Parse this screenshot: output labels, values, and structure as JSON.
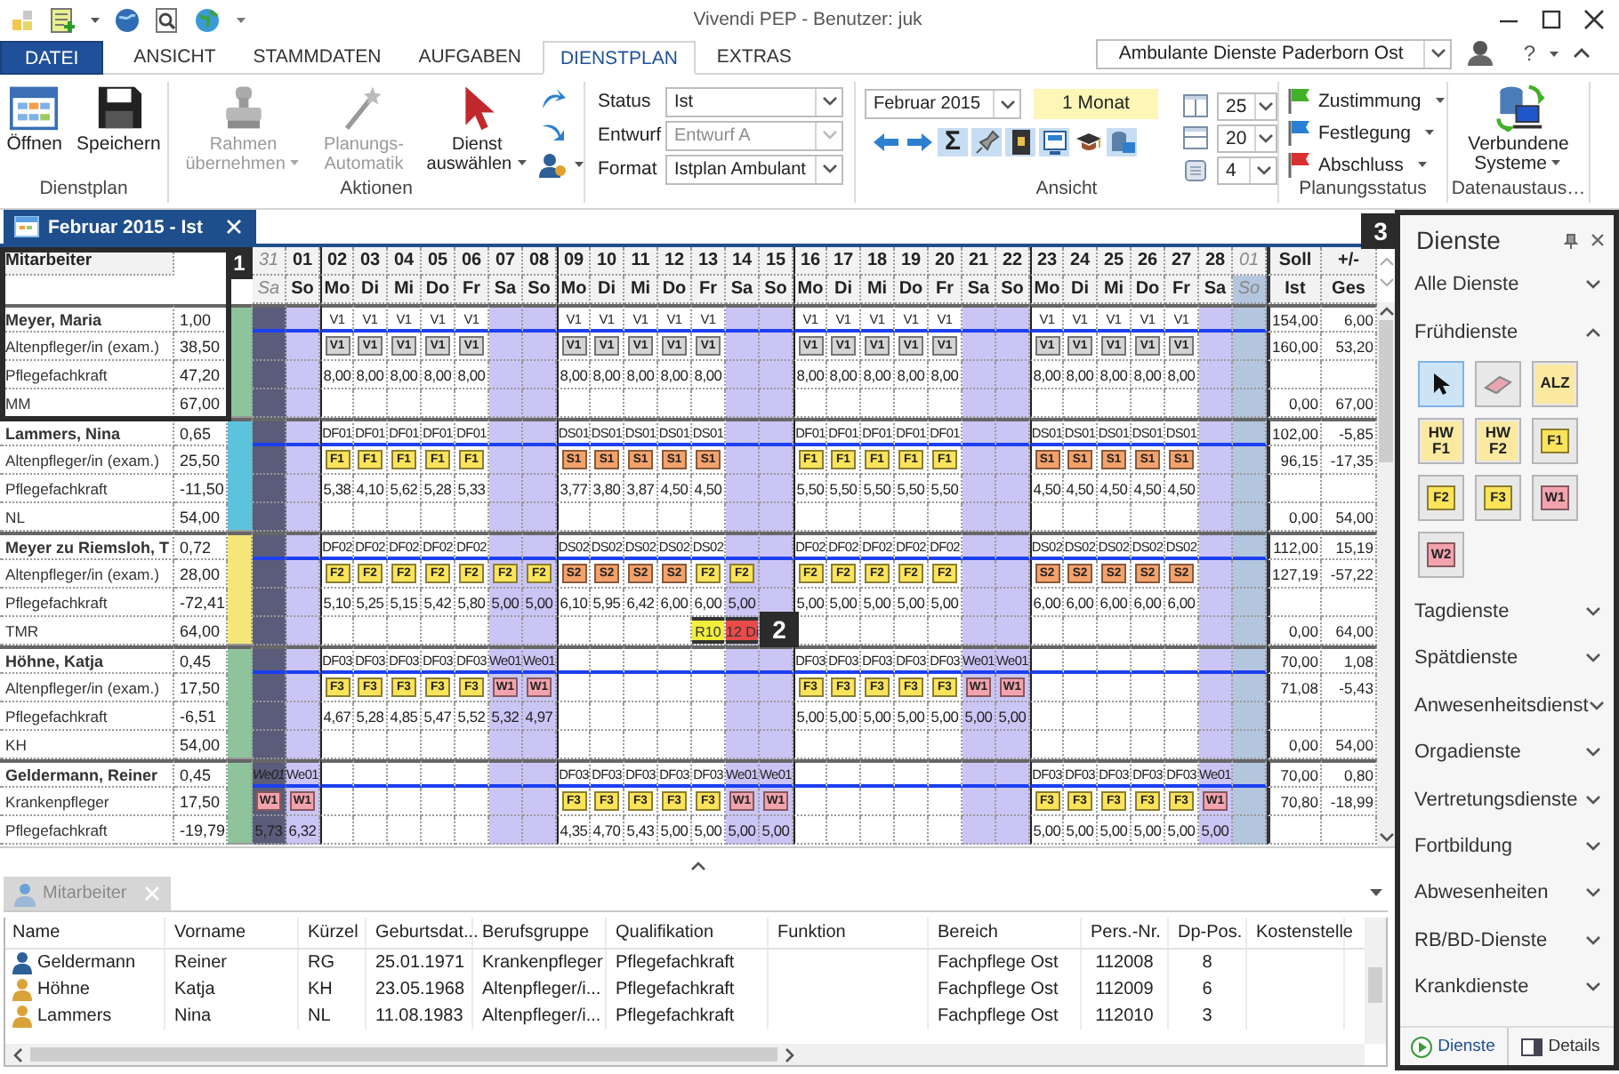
{
  "window": {
    "title": "Vivendi PEP - Benutzer: juk"
  },
  "ribbon_tabs": [
    {
      "label": "DATEI",
      "kind": "file",
      "selected": false
    },
    {
      "label": "ANSICHT",
      "kind": "tab",
      "selected": false
    },
    {
      "label": "STAMMDATEN",
      "kind": "tab",
      "selected": false
    },
    {
      "label": "AUFGABEN",
      "kind": "tab",
      "selected": false
    },
    {
      "label": "DIENSTPLAN",
      "kind": "tab",
      "selected": true
    },
    {
      "label": "EXTRAS",
      "kind": "tab",
      "selected": false
    }
  ],
  "location": "Ambulante Dienste Paderborn Ost",
  "help": "?",
  "ribbon": {
    "dienstplan": {
      "label": "Dienstplan",
      "buttons": [
        {
          "label": "Öffnen"
        },
        {
          "label": "Speichern"
        }
      ]
    },
    "aktionen": {
      "label": "Aktionen",
      "buttons": [
        {
          "label": "Rahmen übernehmen",
          "disabled": true,
          "dropdown": true
        },
        {
          "label": "Planungs-Automatik",
          "disabled": true,
          "dropdown": false
        },
        {
          "label": "Dienst auswählen",
          "disabled": false,
          "dropdown": true
        }
      ]
    },
    "fields": [
      {
        "label": "Status",
        "value": "Ist",
        "disabled": false
      },
      {
        "label": "Entwurf",
        "value": "Entwurf A",
        "disabled": true
      },
      {
        "label": "Format",
        "value": "Istplan Ambulant",
        "disabled": false
      }
    ],
    "ansicht": {
      "label": "Ansicht",
      "month": "Februar 2015",
      "range": "1 Monat",
      "tools": [
        {
          "kind": "back",
          "pressed": false
        },
        {
          "kind": "forward",
          "pressed": false
        },
        {
          "kind": "sum",
          "label": "Σ",
          "pressed": true
        },
        {
          "kind": "pin",
          "pressed": true
        },
        {
          "kind": "book",
          "pressed": true
        },
        {
          "kind": "monitor",
          "pressed": true
        },
        {
          "kind": "cap",
          "pressed": false
        },
        {
          "kind": "database",
          "pressed": true
        }
      ],
      "spinners": [
        {
          "kind": "columns",
          "value": "25"
        },
        {
          "kind": "rows",
          "value": "20"
        },
        {
          "kind": "square",
          "value": "4"
        }
      ]
    },
    "planungsstatus": {
      "label": "Planungsstatus",
      "items": [
        {
          "label": "Zustimmung",
          "color": "#43b02a"
        },
        {
          "label": "Festlegung",
          "color": "#2a7fd4"
        },
        {
          "label": "Abschluss",
          "color": "#d83030"
        }
      ]
    },
    "datenaustausch": {
      "label": "Datenaustaus…",
      "button": "Verbundene Systeme"
    }
  },
  "document_tab": "Februar 2015 - Ist",
  "grid": {
    "name_header": "Mitarbeiter",
    "totals_headers": [
      {
        "top": "Soll",
        "bottom": "Ist"
      },
      {
        "top": "+/-",
        "bottom": "Ges"
      }
    ]
  },
  "days": [
    {
      "day": "31",
      "weekday": "Sa",
      "kind": "prev"
    },
    {
      "day": "01",
      "weekday": "So",
      "kind": "weekend"
    },
    {
      "day": "02",
      "weekday": "Mo",
      "kind": "weekday"
    },
    {
      "day": "03",
      "weekday": "Di",
      "kind": "weekday"
    },
    {
      "day": "04",
      "weekday": "Mi",
      "kind": "weekday"
    },
    {
      "day": "05",
      "weekday": "Do",
      "kind": "weekday"
    },
    {
      "day": "06",
      "weekday": "Fr",
      "kind": "weekday"
    },
    {
      "day": "07",
      "weekday": "Sa",
      "kind": "weekend"
    },
    {
      "day": "08",
      "weekday": "So",
      "kind": "weekend"
    },
    {
      "day": "09",
      "weekday": "Mo",
      "kind": "weekday"
    },
    {
      "day": "10",
      "weekday": "Di",
      "kind": "weekday"
    },
    {
      "day": "11",
      "weekday": "Mi",
      "kind": "weekday"
    },
    {
      "day": "12",
      "weekday": "Do",
      "kind": "weekday"
    },
    {
      "day": "13",
      "weekday": "Fr",
      "kind": "weekday"
    },
    {
      "day": "14",
      "weekday": "Sa",
      "kind": "weekend"
    },
    {
      "day": "15",
      "weekday": "So",
      "kind": "weekend"
    },
    {
      "day": "16",
      "weekday": "Mo",
      "kind": "weekday"
    },
    {
      "day": "17",
      "weekday": "Di",
      "kind": "weekday"
    },
    {
      "day": "18",
      "weekday": "Mi",
      "kind": "weekday"
    },
    {
      "day": "19",
      "weekday": "Do",
      "kind": "weekday"
    },
    {
      "day": "20",
      "weekday": "Fr",
      "kind": "weekday"
    },
    {
      "day": "21",
      "weekday": "Sa",
      "kind": "weekend"
    },
    {
      "day": "22",
      "weekday": "So",
      "kind": "weekend"
    },
    {
      "day": "23",
      "weekday": "Mo",
      "kind": "weekday"
    },
    {
      "day": "24",
      "weekday": "Di",
      "kind": "weekday"
    },
    {
      "day": "25",
      "weekday": "Mi",
      "kind": "weekday"
    },
    {
      "day": "26",
      "weekday": "Do",
      "kind": "weekday"
    },
    {
      "day": "27",
      "weekday": "Fr",
      "kind": "weekday"
    },
    {
      "day": "28",
      "weekday": "Sa",
      "kind": "weekend"
    },
    {
      "day": "01",
      "weekday": "So",
      "kind": "next"
    }
  ],
  "employees": [
    {
      "color": "#8ec39c",
      "rows": [
        {
          "label": "Meyer, Maria",
          "value": "1,00",
          "kind": "codes",
          "soll": "154,00",
          "diff": "6,00",
          "cells": [
            null,
            null,
            "V1",
            "V1",
            "V1",
            "V1",
            "V1",
            null,
            null,
            "V1",
            "V1",
            "V1",
            "V1",
            "V1",
            null,
            null,
            "V1",
            "V1",
            "V1",
            "V1",
            "V1",
            null,
            null,
            "V1",
            "V1",
            "V1",
            "V1",
            "V1",
            null,
            null
          ]
        },
        {
          "label": "Altenpfleger/in (exam.)",
          "value": "38,50",
          "kind": "badges",
          "soll": "160,00",
          "diff": "53,20",
          "cells": [
            null,
            null,
            {
              "code": "V1",
              "color": "#d4d4d4"
            },
            {
              "code": "V1",
              "color": "#d4d4d4"
            },
            {
              "code": "V1",
              "color": "#d4d4d4"
            },
            {
              "code": "V1",
              "color": "#d4d4d4"
            },
            {
              "code": "V1",
              "color": "#d4d4d4"
            },
            null,
            null,
            {
              "code": "V1",
              "color": "#d4d4d4"
            },
            {
              "code": "V1",
              "color": "#d4d4d4"
            },
            {
              "code": "V1",
              "color": "#d4d4d4"
            },
            {
              "code": "V1",
              "color": "#d4d4d4"
            },
            {
              "code": "V1",
              "color": "#d4d4d4"
            },
            null,
            null,
            {
              "code": "V1",
              "color": "#d4d4d4"
            },
            {
              "code": "V1",
              "color": "#d4d4d4"
            },
            {
              "code": "V1",
              "color": "#d4d4d4"
            },
            {
              "code": "V1",
              "color": "#d4d4d4"
            },
            {
              "code": "V1",
              "color": "#d4d4d4"
            },
            null,
            null,
            {
              "code": "V1",
              "color": "#d4d4d4"
            },
            {
              "code": "V1",
              "color": "#d4d4d4"
            },
            {
              "code": "V1",
              "color": "#d4d4d4"
            },
            {
              "code": "V1",
              "color": "#d4d4d4"
            },
            {
              "code": "V1",
              "color": "#d4d4d4"
            },
            null,
            null
          ]
        },
        {
          "label": "Pflegefachkraft",
          "value": "47,20",
          "kind": "hours",
          "cells": [
            null,
            null,
            "8,00",
            "8,00",
            "8,00",
            "8,00",
            "8,00",
            null,
            null,
            "8,00",
            "8,00",
            "8,00",
            "8,00",
            "8,00",
            null,
            null,
            "8,00",
            "8,00",
            "8,00",
            "8,00",
            "8,00",
            null,
            null,
            "8,00",
            "8,00",
            "8,00",
            "8,00",
            "8,00",
            null,
            null
          ]
        },
        {
          "label": "MM",
          "value": "67,00",
          "kind": "blank",
          "soll": "0,00",
          "diff": "67,00"
        }
      ]
    },
    {
      "color": "#5bc4dc",
      "rows": [
        {
          "label": "Lammers, Nina",
          "value": "0,65",
          "kind": "codes",
          "soll": "102,00",
          "diff": "-5,85",
          "cells": [
            null,
            null,
            "DF01",
            "DF01",
            "DF01",
            "DF01",
            "DF01",
            null,
            null,
            "DS01",
            "DS01",
            "DS01",
            "DS01",
            "DS01",
            null,
            null,
            "DF01",
            "DF01",
            "DF01",
            "DF01",
            "DF01",
            null,
            null,
            "DS01",
            "DS01",
            "DS01",
            "DS01",
            "DS01",
            null,
            null
          ]
        },
        {
          "label": "Altenpfleger/in (exam.)",
          "value": "25,50",
          "kind": "badges",
          "soll": "96,15",
          "diff": "-17,35",
          "cells": [
            null,
            null,
            {
              "code": "F1",
              "color": "#fbe35a"
            },
            {
              "code": "F1",
              "color": "#fbe35a"
            },
            {
              "code": "F1",
              "color": "#fbe35a"
            },
            {
              "code": "F1",
              "color": "#fbe35a"
            },
            {
              "code": "F1",
              "color": "#fbe35a"
            },
            null,
            null,
            {
              "code": "S1",
              "color": "#f4a26c"
            },
            {
              "code": "S1",
              "color": "#f4a26c"
            },
            {
              "code": "S1",
              "color": "#f4a26c"
            },
            {
              "code": "S1",
              "color": "#f4a26c"
            },
            {
              "code": "S1",
              "color": "#f4a26c"
            },
            null,
            null,
            {
              "code": "F1",
              "color": "#fbe35a"
            },
            {
              "code": "F1",
              "color": "#fbe35a"
            },
            {
              "code": "F1",
              "color": "#fbe35a"
            },
            {
              "code": "F1",
              "color": "#fbe35a"
            },
            {
              "code": "F1",
              "color": "#fbe35a"
            },
            null,
            null,
            {
              "code": "S1",
              "color": "#f4a26c"
            },
            {
              "code": "S1",
              "color": "#f4a26c"
            },
            {
              "code": "S1",
              "color": "#f4a26c"
            },
            {
              "code": "S1",
              "color": "#f4a26c"
            },
            {
              "code": "S1",
              "color": "#f4a26c"
            },
            null,
            null
          ]
        },
        {
          "label": "Pflegefachkraft",
          "value": "-11,50",
          "kind": "hours",
          "cells": [
            null,
            null,
            "5,38",
            "4,10",
            "5,62",
            "5,28",
            "5,33",
            null,
            null,
            "3,77",
            "3,80",
            "3,87",
            "4,50",
            "4,50",
            null,
            null,
            "5,50",
            "5,50",
            "5,50",
            "5,50",
            "5,50",
            null,
            null,
            "4,50",
            "4,50",
            "4,50",
            "4,50",
            "4,50",
            null,
            null
          ]
        },
        {
          "label": "NL",
          "value": "54,00",
          "kind": "blank",
          "soll": "0,00",
          "diff": "54,00"
        }
      ]
    },
    {
      "color": "#f5e67a",
      "rows": [
        {
          "label": "Meyer zu Riemsloh, T",
          "value": "0,72",
          "kind": "codes",
          "soll": "112,00",
          "diff": "15,19",
          "cells": [
            null,
            null,
            "DF02",
            "DF02",
            "DF02",
            "DF02",
            "DF02",
            null,
            null,
            "DS02",
            "DS02",
            "DS02",
            "DS02",
            "DS02",
            null,
            null,
            "DF02",
            "DF02",
            "DF02",
            "DF02",
            "DF02",
            null,
            null,
            "DS02",
            "DS02",
            "DS02",
            "DS02",
            "DS02",
            null,
            null
          ]
        },
        {
          "label": "Altenpfleger/in (exam.)",
          "value": "28,00",
          "kind": "badges",
          "soll": "127,19",
          "diff": "-57,22",
          "cells": [
            null,
            null,
            {
              "code": "F2",
              "color": "#fbe35a"
            },
            {
              "code": "F2",
              "color": "#fbe35a"
            },
            {
              "code": "F2",
              "color": "#fbe35a"
            },
            {
              "code": "F2",
              "color": "#fbe35a"
            },
            {
              "code": "F2",
              "color": "#fbe35a"
            },
            {
              "code": "F2",
              "color": "#fbe35a"
            },
            {
              "code": "F2",
              "color": "#fbe35a"
            },
            {
              "code": "S2",
              "color": "#f4a26c"
            },
            {
              "code": "S2",
              "color": "#f4a26c"
            },
            {
              "code": "S2",
              "color": "#f4a26c"
            },
            {
              "code": "S2",
              "color": "#f4a26c"
            },
            {
              "code": "F2",
              "color": "#fbe35a"
            },
            {
              "code": "F2",
              "color": "#fbe35a"
            },
            null,
            {
              "code": "F2",
              "color": "#fbe35a"
            },
            {
              "code": "F2",
              "color": "#fbe35a"
            },
            {
              "code": "F2",
              "color": "#fbe35a"
            },
            {
              "code": "F2",
              "color": "#fbe35a"
            },
            {
              "code": "F2",
              "color": "#fbe35a"
            },
            null,
            null,
            {
              "code": "S2",
              "color": "#f4a26c"
            },
            {
              "code": "S2",
              "color": "#f4a26c"
            },
            {
              "code": "S2",
              "color": "#f4a26c"
            },
            {
              "code": "S2",
              "color": "#f4a26c"
            },
            {
              "code": "S2",
              "color": "#f4a26c"
            },
            null,
            null
          ]
        },
        {
          "label": "Pflegefachkraft",
          "value": "-72,41",
          "kind": "hours",
          "cells": [
            null,
            null,
            "5,10",
            "5,25",
            "5,15",
            "5,42",
            "5,80",
            "5,00",
            "5,00",
            "6,10",
            "5,95",
            "6,42",
            "6,00",
            "6,00",
            "5,00",
            null,
            "5,00",
            "5,00",
            "5,00",
            "5,00",
            "5,00",
            null,
            null,
            "6,00",
            "6,00",
            "6,00",
            "6,00",
            "6,00",
            null,
            null
          ]
        },
        {
          "label": "TMR",
          "value": "64,00",
          "kind": "flags",
          "soll": "0,00",
          "diff": "64,00",
          "cells": [
            null,
            null,
            null,
            null,
            null,
            null,
            null,
            null,
            null,
            null,
            null,
            null,
            null,
            {
              "code": "R10",
              "color": "#f2ee3c"
            },
            {
              "code": "12 Di",
              "color": "#e94b4b"
            },
            null,
            null,
            null,
            null,
            null,
            null,
            null,
            null,
            null,
            null,
            null,
            null,
            null,
            null,
            null
          ]
        }
      ]
    },
    {
      "color": "#8ec39c",
      "rows": [
        {
          "label": "Höhne, Katja",
          "value": "0,45",
          "kind": "codes",
          "soll": "70,00",
          "diff": "1,08",
          "cells": [
            null,
            null,
            "DF03",
            "DF03",
            "DF03",
            "DF03",
            "DF03",
            "We01",
            "We01",
            null,
            null,
            null,
            null,
            null,
            null,
            null,
            "DF03",
            "DF03",
            "DF03",
            "DF03",
            "DF03",
            "We01",
            "We01",
            null,
            null,
            null,
            null,
            null,
            null,
            null
          ]
        },
        {
          "label": "Altenpfleger/in (exam.)",
          "value": "17,50",
          "kind": "badges",
          "soll": "71,08",
          "diff": "-5,43",
          "cells": [
            null,
            null,
            {
              "code": "F3",
              "color": "#fbe35a"
            },
            {
              "code": "F3",
              "color": "#fbe35a"
            },
            {
              "code": "F3",
              "color": "#fbe35a"
            },
            {
              "code": "F3",
              "color": "#fbe35a"
            },
            {
              "code": "F3",
              "color": "#fbe35a"
            },
            {
              "code": "W1",
              "color": "#f2a3ad"
            },
            {
              "code": "W1",
              "color": "#f2a3ad"
            },
            null,
            null,
            null,
            null,
            null,
            null,
            null,
            {
              "code": "F3",
              "color": "#fbe35a"
            },
            {
              "code": "F3",
              "color": "#fbe35a"
            },
            {
              "code": "F3",
              "color": "#fbe35a"
            },
            {
              "code": "F3",
              "color": "#fbe35a"
            },
            {
              "code": "F3",
              "color": "#fbe35a"
            },
            {
              "code": "W1",
              "color": "#f2a3ad"
            },
            {
              "code": "W1",
              "color": "#f2a3ad"
            },
            null,
            null,
            null,
            null,
            null,
            null,
            null
          ]
        },
        {
          "label": "Pflegefachkraft",
          "value": "-6,51",
          "kind": "hours",
          "cells": [
            null,
            null,
            "4,67",
            "5,28",
            "4,85",
            "5,47",
            "5,52",
            "5,32",
            "4,97",
            null,
            null,
            null,
            null,
            null,
            null,
            null,
            "5,00",
            "5,00",
            "5,00",
            "5,00",
            "5,00",
            "5,00",
            "5,00",
            null,
            null,
            null,
            null,
            null,
            null,
            null
          ]
        },
        {
          "label": "KH",
          "value": "54,00",
          "kind": "blank",
          "soll": "0,00",
          "diff": "54,00"
        }
      ]
    },
    {
      "color": "#8ec39c",
      "rows": [
        {
          "label": "Geldermann, Reiner",
          "value": "0,45",
          "kind": "codes",
          "soll": "70,00",
          "diff": "0,80",
          "cells": [
            "We01",
            "We01",
            null,
            null,
            null,
            null,
            null,
            null,
            null,
            "DF03",
            "DF03",
            "DF03",
            "DF03",
            "DF03",
            "We01",
            "We01",
            null,
            null,
            null,
            null,
            null,
            null,
            null,
            "DF03",
            "DF03",
            "DF03",
            "DF03",
            "DF03",
            "We01",
            null
          ]
        },
        {
          "label": "Krankenpfleger",
          "value": "17,50",
          "kind": "badges",
          "soll": "70,80",
          "diff": "-18,99",
          "cells": [
            {
              "code": "W1",
              "color": "#f2a3ad"
            },
            {
              "code": "W1",
              "color": "#f2a3ad"
            },
            null,
            null,
            null,
            null,
            null,
            null,
            null,
            {
              "code": "F3",
              "color": "#fbe35a"
            },
            {
              "code": "F3",
              "color": "#fbe35a"
            },
            {
              "code": "F3",
              "color": "#fbe35a"
            },
            {
              "code": "F3",
              "color": "#fbe35a"
            },
            {
              "code": "F3",
              "color": "#fbe35a"
            },
            {
              "code": "W1",
              "color": "#f2a3ad"
            },
            {
              "code": "W1",
              "color": "#f2a3ad"
            },
            null,
            null,
            null,
            null,
            null,
            null,
            null,
            {
              "code": "F3",
              "color": "#fbe35a"
            },
            {
              "code": "F3",
              "color": "#fbe35a"
            },
            {
              "code": "F3",
              "color": "#fbe35a"
            },
            {
              "code": "F3",
              "color": "#fbe35a"
            },
            {
              "code": "F3",
              "color": "#fbe35a"
            },
            {
              "code": "W1",
              "color": "#f2a3ad"
            },
            null
          ]
        },
        {
          "label": "Pflegefachkraft",
          "value": "-19,79",
          "kind": "hours",
          "cells": [
            "5,73",
            "6,32",
            null,
            null,
            null,
            null,
            null,
            null,
            null,
            "4,35",
            "4,70",
            "5,43",
            "5,00",
            "5,00",
            "5,00",
            "5,00",
            null,
            null,
            null,
            null,
            null,
            null,
            null,
            "5,00",
            "5,00",
            "5,00",
            "5,00",
            "5,00",
            "5,00",
            null
          ]
        }
      ]
    }
  ],
  "callouts": [
    {
      "number": "1"
    },
    {
      "number": "2"
    },
    {
      "number": "3"
    }
  ],
  "staff_panel": {
    "tab": "Mitarbeiter",
    "columns": [
      "Name",
      "Vorname",
      "Kürzel",
      "Geburtsdat...",
      "Berufsgruppe",
      "Qualifikation",
      "Funktion",
      "Bereich",
      "Pers.-Nr.",
      "Dp-Pos.",
      "Kostenstelle"
    ],
    "rows": [
      {
        "kind": "male",
        "cells": [
          "Geldermann",
          "Reiner",
          "RG",
          "25.01.1971",
          "Krankenpfleger",
          "Pflegefachkraft",
          null,
          "Fachpflege Ost",
          "112008",
          "8",
          null
        ]
      },
      {
        "kind": "female",
        "cells": [
          "Höhne",
          "Katja",
          "KH",
          "23.05.1968",
          "Altenpfleger/i...",
          "Pflegefachkraft",
          null,
          "Fachpflege Ost",
          "112009",
          "6",
          null
        ]
      },
      {
        "kind": "female",
        "cells": [
          "Lammers",
          "Nina",
          "NL",
          "11.08.1983",
          "Altenpfleger/i...",
          "Pflegefachkraft",
          null,
          "Fachpflege Ost",
          "112010",
          "3",
          null
        ]
      }
    ]
  },
  "dock": {
    "title": "Dienste",
    "sections": [
      {
        "label": "Alle Dienste",
        "expanded": false
      },
      {
        "label": "Frühdienste",
        "expanded": true,
        "tools": [
          {
            "kind": "pointer",
            "selected": true
          },
          {
            "kind": "eraser",
            "selected": false
          },
          {
            "kind": "tile",
            "text": "ALZ",
            "color": "#fbe9a0",
            "selected": false
          },
          {
            "kind": "tile",
            "text": "HW F1",
            "color": "#fbe9a0",
            "selected": false
          },
          {
            "kind": "tile",
            "text": "HW F2",
            "color": "#fbe9a0",
            "selected": false
          },
          {
            "kind": "badge",
            "text": "F1",
            "color": "#fbe35a",
            "selected": false
          },
          {
            "kind": "badge",
            "text": "F2",
            "color": "#fbe35a",
            "selected": false
          },
          {
            "kind": "badge",
            "text": "F3",
            "color": "#fbe35a",
            "selected": false
          },
          {
            "kind": "badge",
            "text": "W1",
            "color": "#f2a3ad",
            "selected": false
          },
          {
            "kind": "badge",
            "text": "W2",
            "color": "#f2a3ad",
            "selected": false
          }
        ]
      },
      {
        "label": "Tagdienste",
        "expanded": false
      },
      {
        "label": "Spätdienste",
        "expanded": false
      },
      {
        "label": "Anwesenheitsdienst",
        "expanded": false
      },
      {
        "label": "Orgadienste",
        "expanded": false
      },
      {
        "label": "Vertretungsdienste",
        "expanded": false
      },
      {
        "label": "Fortbildung",
        "expanded": false
      },
      {
        "label": "Abwesenheiten",
        "expanded": false
      },
      {
        "label": "RB/BD-Dienste",
        "expanded": false
      },
      {
        "label": "Krankdienste",
        "expanded": false
      }
    ],
    "tabs": [
      {
        "label": "Dienste",
        "selected": true
      },
      {
        "label": "Details",
        "selected": false
      }
    ]
  }
}
